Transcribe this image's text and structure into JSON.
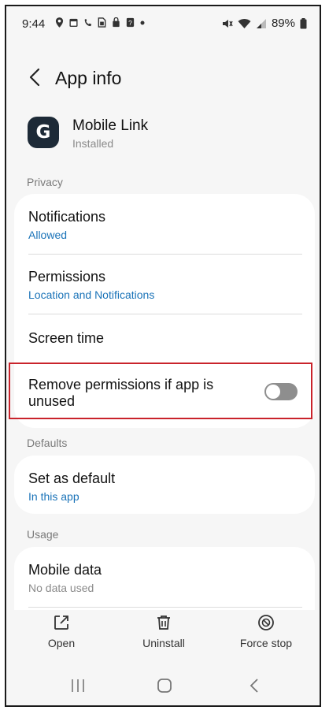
{
  "status_bar": {
    "time": "9:44",
    "battery": "89%",
    "left_icons": [
      "location-icon",
      "calendar-icon",
      "missed-call-icon",
      "sim-icon",
      "lock-info-icon",
      "question-box-icon",
      "dot-icon"
    ],
    "right_icons": [
      "mute-icon",
      "wifi-icon",
      "signal-icon",
      "battery-icon"
    ]
  },
  "header": {
    "title": "App info"
  },
  "app": {
    "name": "Mobile Link",
    "status": "Installed",
    "icon_letter": "G",
    "icon_color": "#1d2a37"
  },
  "sections": {
    "privacy": {
      "label": "Privacy",
      "notifications": {
        "title": "Notifications",
        "sub": "Allowed"
      },
      "permissions": {
        "title": "Permissions",
        "sub": "Location and Notifications"
      },
      "screen_time": {
        "title": "Screen time"
      },
      "remove_permissions": {
        "title_line1": "Remove permissions if app is",
        "title_line2": "unused",
        "enabled": false
      }
    },
    "defaults": {
      "label": "Defaults",
      "set_as_default": {
        "title": "Set as default",
        "sub": "In this app"
      }
    },
    "usage": {
      "label": "Usage",
      "mobile_data": {
        "title": "Mobile data",
        "sub": "No data used"
      }
    }
  },
  "actions": {
    "open": "Open",
    "uninstall": "Uninstall",
    "force_stop": "Force stop"
  },
  "colors": {
    "link": "#1a73b8",
    "highlight": "#c9232b",
    "background": "#f6f6f6"
  }
}
